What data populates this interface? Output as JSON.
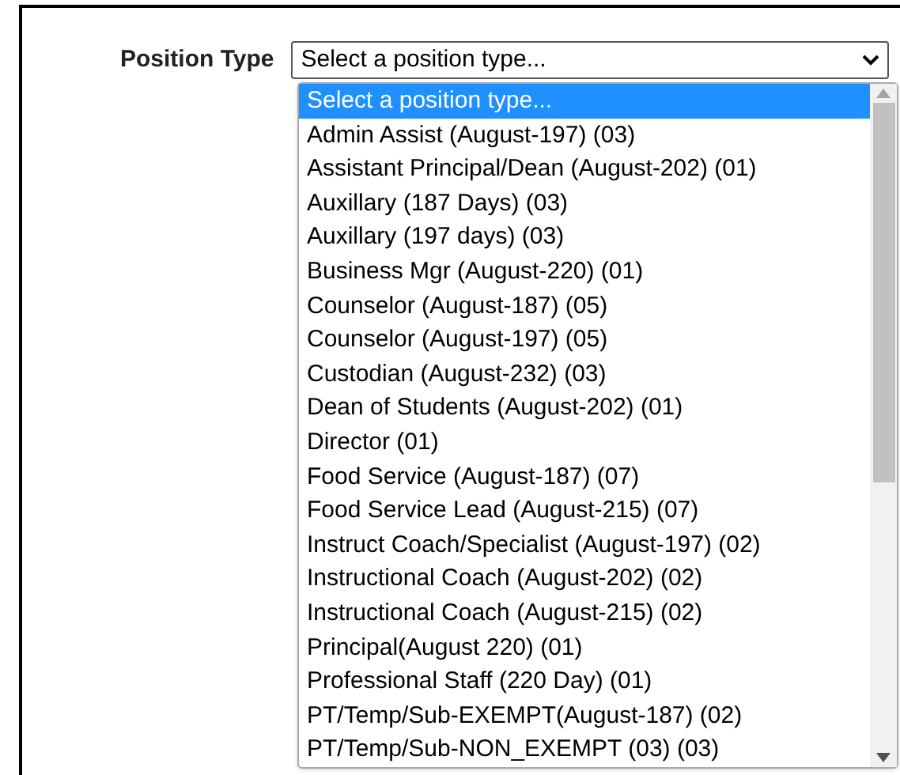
{
  "field": {
    "label": "Position Type",
    "value": "Select a position type..."
  },
  "options": [
    {
      "label": "Select a position type...",
      "selected": true
    },
    {
      "label": "Admin Assist (August-197) (03)",
      "selected": false
    },
    {
      "label": "Assistant Principal/Dean (August-202) (01)",
      "selected": false
    },
    {
      "label": "Auxillary (187 Days) (03)",
      "selected": false
    },
    {
      "label": "Auxillary (197 days) (03)",
      "selected": false
    },
    {
      "label": "Business Mgr (August-220) (01)",
      "selected": false
    },
    {
      "label": "Counselor (August-187) (05)",
      "selected": false
    },
    {
      "label": "Counselor (August-197) (05)",
      "selected": false
    },
    {
      "label": "Custodian (August-232) (03)",
      "selected": false
    },
    {
      "label": "Dean of Students (August-202) (01)",
      "selected": false
    },
    {
      "label": "Director (01)",
      "selected": false
    },
    {
      "label": "Food Service (August-187) (07)",
      "selected": false
    },
    {
      "label": "Food Service Lead (August-215) (07)",
      "selected": false
    },
    {
      "label": "Instruct Coach/Specialist (August-197) (02)",
      "selected": false
    },
    {
      "label": "Instructional Coach (August-202) (02)",
      "selected": false
    },
    {
      "label": "Instructional Coach (August-215) (02)",
      "selected": false
    },
    {
      "label": "Principal(August 220) (01)",
      "selected": false
    },
    {
      "label": "Professional Staff (220 Day) (01)",
      "selected": false
    },
    {
      "label": "PT/Temp/Sub-EXEMPT(August-187) (02)",
      "selected": false
    },
    {
      "label": "PT/Temp/Sub-NON_EXEMPT (03) (03)",
      "selected": false
    }
  ]
}
